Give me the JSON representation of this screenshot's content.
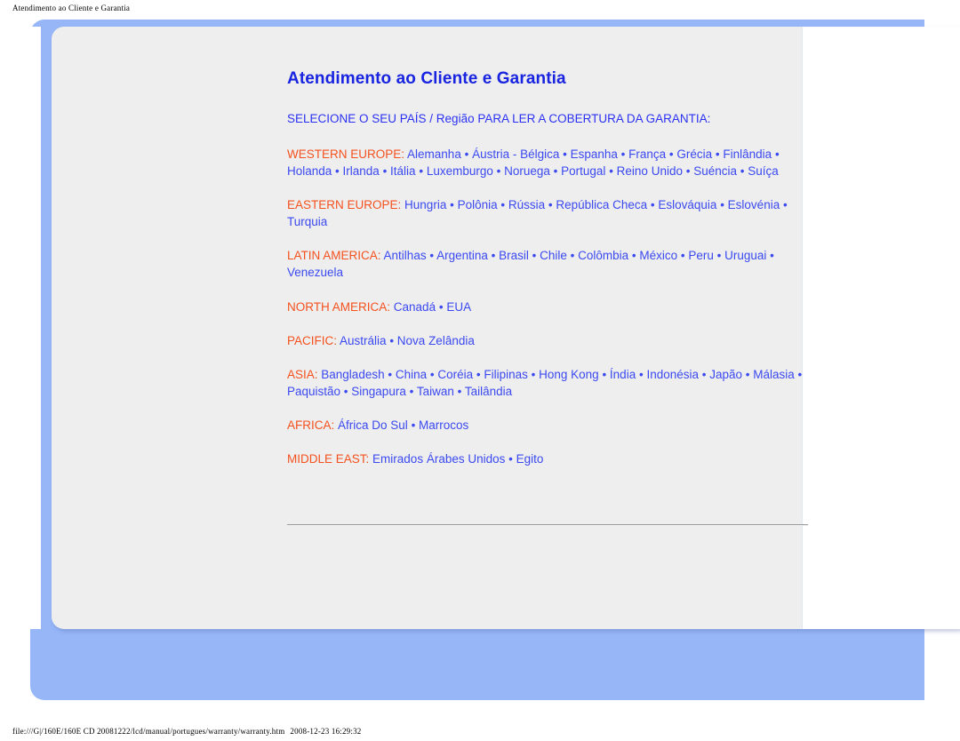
{
  "print_header": "Atendimento ao Cliente e Garantia",
  "print_footer": {
    "path": "file:///G|/160E/160E CD 20081222/lcd/manual/portugues/warranty/warranty.htm",
    "timestamp": "2008-12-23 16:29:32"
  },
  "colors": {
    "frame_blue": "#96b6f8",
    "sheet_grey": "#eeeeee",
    "title_blue": "#1824e0",
    "link_blue": "#3b49f0",
    "label_orange": "#f4511e"
  },
  "document": {
    "title": "Atendimento ao Cliente e Garantia",
    "intro": "SELECIONE O SEU PAÍS / Região PARA LER A COBERTURA DA GARANTIA:",
    "separator": "•",
    "regions": [
      {
        "label": "WESTERN EUROPE:",
        "countries": [
          "Alemanha",
          "Áustria - Bélgica",
          "Espanha",
          "França",
          "Grécia",
          "Finlândia",
          "Holanda",
          "Irlanda",
          "Itália",
          "Luxemburgo",
          "Noruega",
          "Portugal",
          "Reino Unido",
          "Suéncia",
          "Suíça"
        ]
      },
      {
        "label": "EASTERN EUROPE:",
        "countries": [
          "Hungria",
          "Polônia",
          "Rússia",
          "República Checa",
          "Eslováquia",
          "Eslovénia",
          "Turquia"
        ]
      },
      {
        "label": "LATIN AMERICA:",
        "countries": [
          "Antilhas",
          "Argentina",
          "Brasil",
          "Chile",
          "Colômbia",
          "México",
          "Peru",
          "Uruguai",
          "Venezuela"
        ]
      },
      {
        "label": "NORTH AMERICA:",
        "countries": [
          "Canadá",
          "EUA"
        ]
      },
      {
        "label": "PACIFIC:",
        "countries": [
          "Austrália",
          "Nova Zelândia"
        ]
      },
      {
        "label": "ASIA:",
        "countries": [
          "Bangladesh",
          "China",
          "Coréia",
          "Filipinas",
          "Hong Kong",
          "Índia",
          "Indonésia",
          "Japão",
          "Málasia",
          "Paquistão",
          "Singapura",
          "Taiwan",
          "Tailândia"
        ]
      },
      {
        "label": "AFRICA:",
        "countries": [
          "África Do Sul",
          "Marrocos"
        ]
      },
      {
        "label": "MIDDLE EAST:",
        "countries": [
          "Emirados Árabes Unidos",
          "Egito"
        ]
      }
    ]
  }
}
